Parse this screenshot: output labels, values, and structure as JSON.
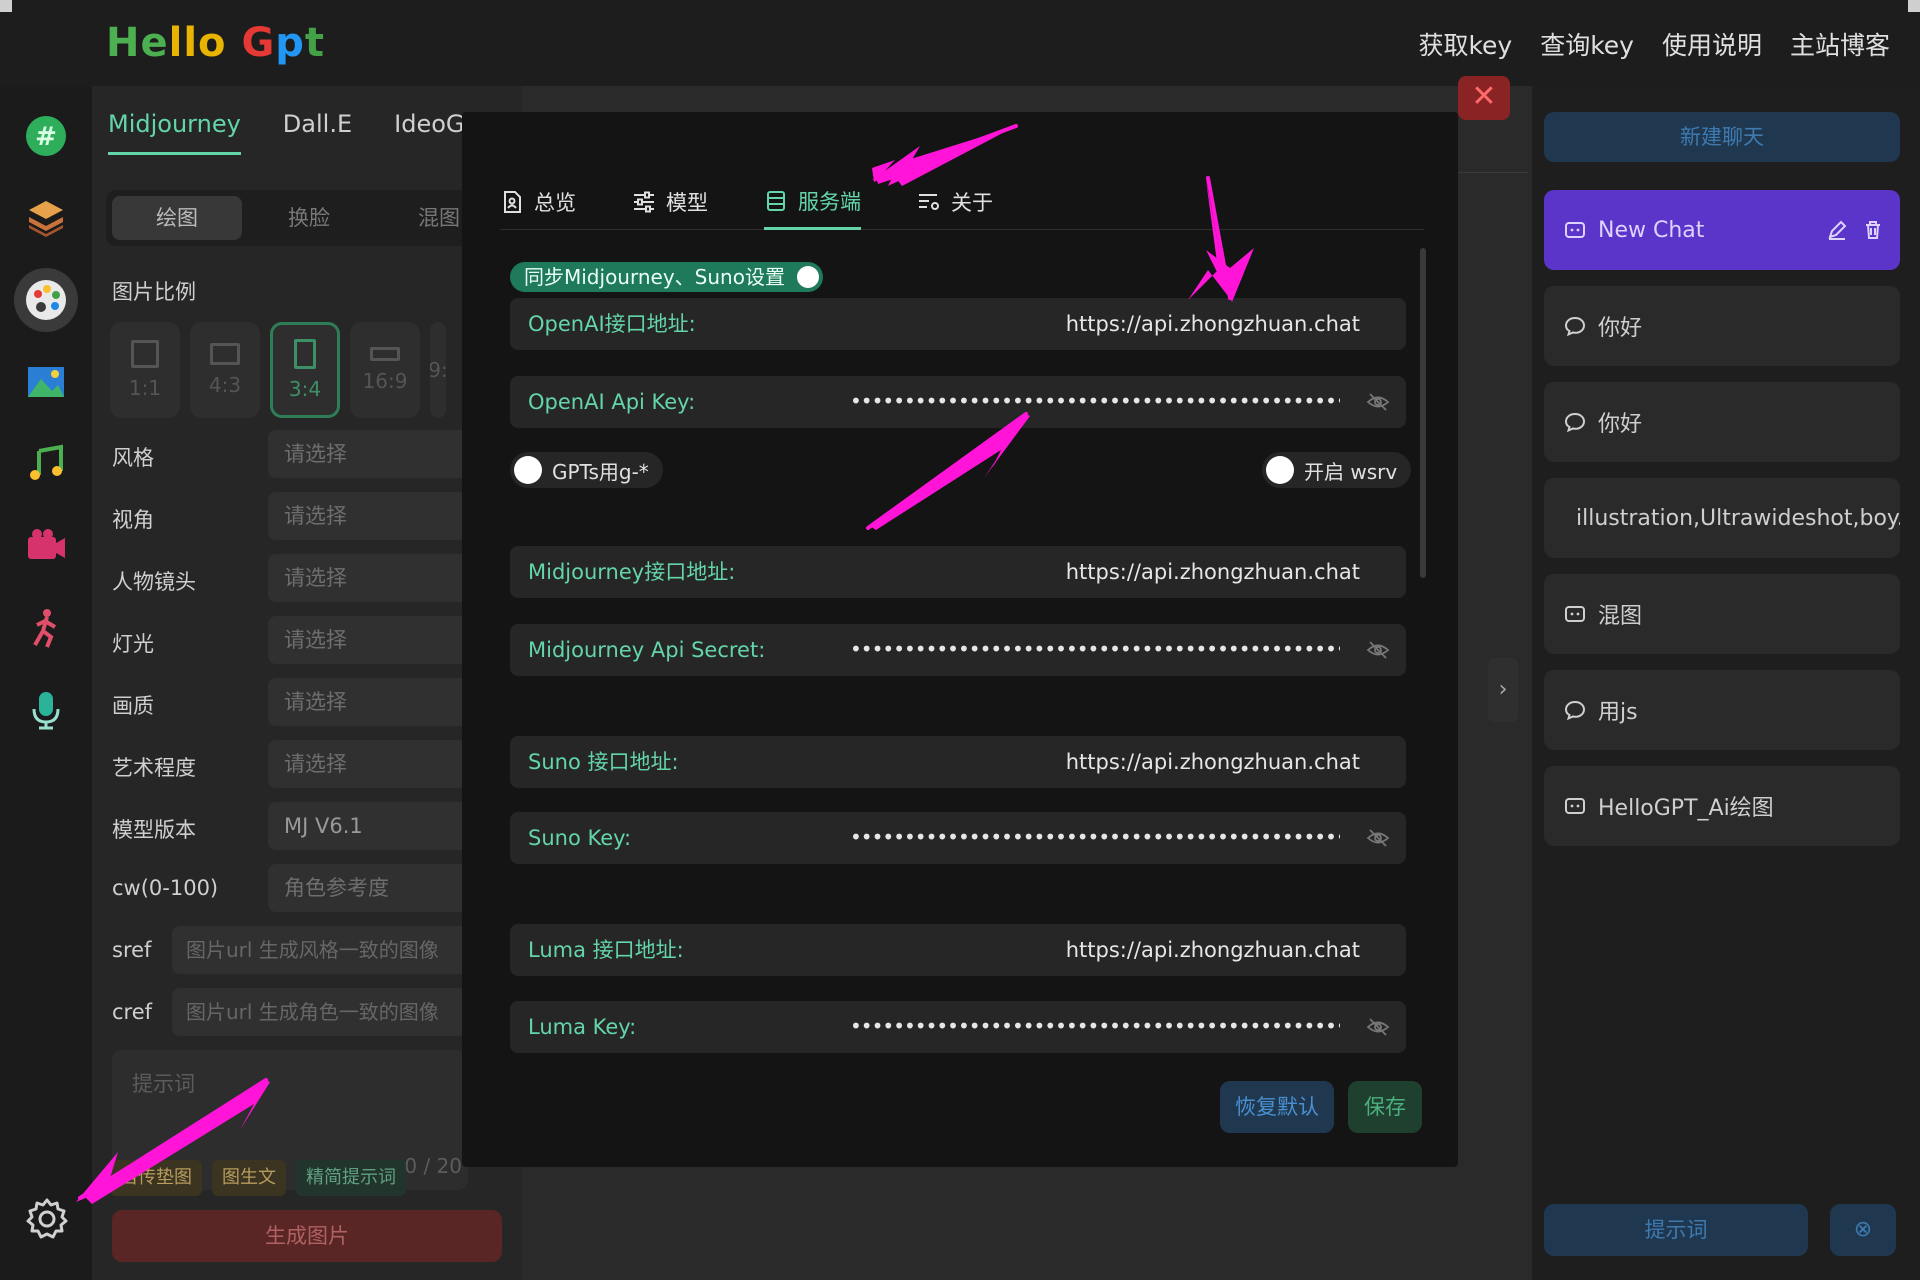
{
  "header": {
    "logo_parts": [
      "He",
      "llo",
      " G",
      "p",
      "t"
    ],
    "nav": [
      "获取key",
      "查询key",
      "使用说明",
      "主站博客"
    ]
  },
  "rail": {
    "icons": [
      "hash-icon",
      "layers-icon",
      "palette-icon",
      "image-icon",
      "music-icon",
      "video-icon",
      "dance-icon",
      "mic-icon",
      "settings-icon"
    ]
  },
  "left": {
    "tabs": [
      "Midjourney",
      "Dall.E",
      "IdeoGram"
    ],
    "segments": [
      "绘图",
      "换脸",
      "混图"
    ],
    "ratio_label": "图片比例",
    "ratios": [
      "1:1",
      "4:3",
      "3:4",
      "16:9",
      "9:"
    ],
    "rows": [
      {
        "label": "风格",
        "value": "请选择"
      },
      {
        "label": "视角",
        "value": "请选择"
      },
      {
        "label": "人物镜头",
        "value": "请选择"
      },
      {
        "label": "灯光",
        "value": "请选择"
      },
      {
        "label": "画质",
        "value": "请选择"
      },
      {
        "label": "艺术程度",
        "value": "请选择"
      },
      {
        "label": "模型版本",
        "value": "MJ V6.1"
      },
      {
        "label": "cw(0-100)",
        "value": "角色参考度"
      }
    ],
    "sref_label": "sref",
    "sref_placeholder": "图片url 生成风格一致的图像",
    "cref_label": "cref",
    "cref_placeholder": "图片url 生成角色一致的图像",
    "prompt_placeholder": "提示词",
    "prompt_count": "0 / 20",
    "chips": [
      "自传垫图",
      "图生文",
      "精简提示词"
    ],
    "generate": "生成图片"
  },
  "modal": {
    "tabs": [
      "总览",
      "模型",
      "服务端",
      "关于"
    ],
    "sync_label": "同步Midjourney、Suno设置",
    "fields": [
      {
        "label": "OpenAI接口地址:",
        "value": "https://api.zhongzhuan.chat",
        "secret": false
      },
      {
        "label": "OpenAI Api Key:",
        "value": "",
        "secret": true
      },
      {
        "label": "Midjourney接口地址:",
        "value": "https://api.zhongzhuan.chat",
        "secret": false
      },
      {
        "label": "Midjourney Api Secret:",
        "value": "",
        "secret": true
      },
      {
        "label": "Suno 接口地址:",
        "value": "https://api.zhongzhuan.chat",
        "secret": false
      },
      {
        "label": "Suno Key:",
        "value": "",
        "secret": true
      },
      {
        "label": "Luma 接口地址:",
        "value": "https://api.zhongzhuan.chat",
        "secret": false
      },
      {
        "label": "Luma Key:",
        "value": "",
        "secret": true
      }
    ],
    "gpts_switch": "GPTs用g-*",
    "wsrv_switch": "开启 wsrv",
    "reset": "恢复默认",
    "save": "保存",
    "close": "✕"
  },
  "right": {
    "new_chat": "新建聊天",
    "chats": [
      {
        "title": "New Chat",
        "icon": "chat-square-icon",
        "active": true
      },
      {
        "title": "你好",
        "icon": "chat-bubble-icon",
        "active": false
      },
      {
        "title": "你好",
        "icon": "chat-bubble-icon",
        "active": false
      },
      {
        "title": "illustration,Ultrawideshot,boy...",
        "icon": "chat-bubble-icon",
        "active": false
      },
      {
        "title": "混图",
        "icon": "chat-square-icon",
        "active": false
      },
      {
        "title": "用js",
        "icon": "chat-bubble-icon",
        "active": false
      },
      {
        "title": "HelloGPT_Ai绘图",
        "icon": "chat-square-icon",
        "active": false
      }
    ],
    "prompt_btn": "提示词",
    "clear_icon": "⊗"
  },
  "colors": {
    "accent": "#63d5a8",
    "active_chat": "#5b34c9",
    "annotation_arrow": "#ff14d8"
  }
}
